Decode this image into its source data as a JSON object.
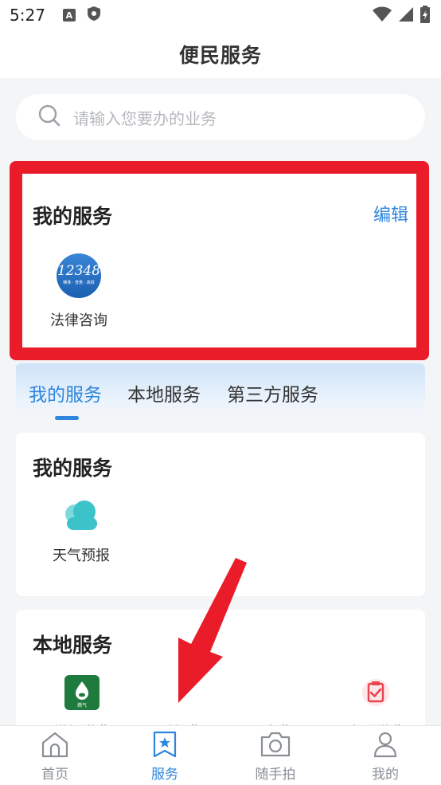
{
  "status_bar": {
    "time": "5:27",
    "icons": [
      "a-badge-icon",
      "shield-icon",
      "wifi-icon",
      "signal-icon",
      "battery-icon"
    ]
  },
  "header": {
    "title": "便民服务"
  },
  "search": {
    "placeholder": "请输入您要办的业务"
  },
  "my_services_card": {
    "title": "我的服务",
    "edit_label": "编辑",
    "items": [
      {
        "label": "法律咨询",
        "badge_text": "12348",
        "badge_sub": "精准 · 普惠 · 高效",
        "icon": "law-12348-icon"
      }
    ]
  },
  "tabs": [
    {
      "label": "我的服务",
      "active": true
    },
    {
      "label": "本地服务",
      "active": false
    },
    {
      "label": "第三方服务",
      "active": false
    }
  ],
  "sections": [
    {
      "title": "我的服务",
      "items": [
        {
          "label": "天气预报",
          "icon": "cloud-icon"
        }
      ]
    },
    {
      "title": "本地服务",
      "items": [
        {
          "label": "燃气缴费",
          "icon": "gas-icon",
          "icon_text": "燃气"
        },
        {
          "label": "暖气费",
          "icon": "heating-icon"
        },
        {
          "label": "水费",
          "icon": "water-icon"
        },
        {
          "label": "生活缴费",
          "icon": "clipboard-check-icon"
        }
      ]
    }
  ],
  "bottom_nav": [
    {
      "label": "首页",
      "icon": "home-icon",
      "active": false
    },
    {
      "label": "服务",
      "icon": "bookmark-star-icon",
      "active": true
    },
    {
      "label": "随手拍",
      "icon": "camera-icon",
      "active": false
    },
    {
      "label": "我的",
      "icon": "user-icon",
      "active": false
    }
  ],
  "colors": {
    "accent": "#2e86de",
    "highlight": "#ea1c2a",
    "weather": "#3cc3c9",
    "gas_bg": "#1f7a3d",
    "clipboard": "#e8434e"
  }
}
